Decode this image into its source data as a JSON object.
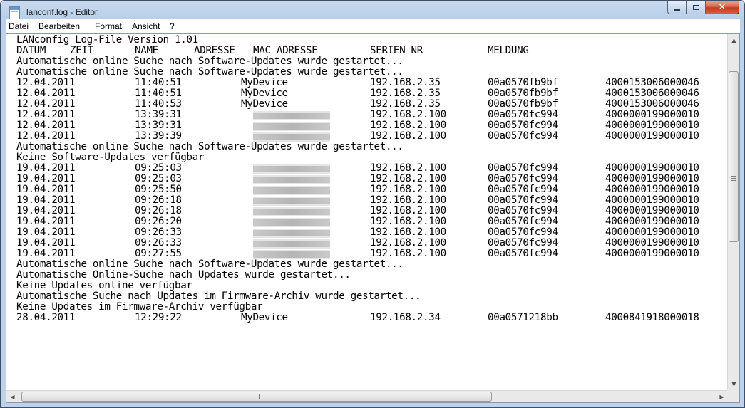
{
  "window": {
    "title": "lanconf.log - Editor"
  },
  "menu": {
    "items": [
      "Datei",
      "Bearbeiten",
      "Format",
      "Ansicht",
      "?"
    ]
  },
  "log": {
    "title_line": "LANconfig Log-File Version 1.01",
    "header": {
      "datum": "DATUM",
      "zeit": "ZEIT",
      "name": "NAME",
      "adresse": "ADRESSE",
      "mac_adresse": "MAC_ADRESSE",
      "serien_nr": "SERIEN_NR",
      "meldung": "MELDUNG"
    },
    "lines": [
      {
        "kind": "message",
        "text": "Automatische online Suche nach Software-Updates wurde gestartet..."
      },
      {
        "kind": "message",
        "text": "Automatische online Suche nach Software-Updates wurde gestartet..."
      },
      {
        "kind": "entry",
        "datum": "12.04.2011",
        "zeit": "11:40:51",
        "name": "MyDevice",
        "adresse": "192.168.2.35",
        "mac": "00a0570fb9bf",
        "serial": "4000153006000046"
      },
      {
        "kind": "entry",
        "datum": "12.04.2011",
        "zeit": "11:40:51",
        "name": "MyDevice",
        "adresse": "192.168.2.35",
        "mac": "00a0570fb9bf",
        "serial": "4000153006000046"
      },
      {
        "kind": "entry",
        "datum": "12.04.2011",
        "zeit": "11:40:53",
        "name": "MyDevice",
        "adresse": "192.168.2.35",
        "mac": "00a0570fb9bf",
        "serial": "4000153006000046"
      },
      {
        "kind": "entry",
        "datum": "12.04.2011",
        "zeit": "13:39:31",
        "name": "",
        "redacted": true,
        "adresse": "192.168.2.100",
        "mac": "00a0570fc994",
        "serial": "4000000199000010"
      },
      {
        "kind": "entry",
        "datum": "12.04.2011",
        "zeit": "13:39:31",
        "name": "",
        "redacted": true,
        "adresse": "192.168.2.100",
        "mac": "00a0570fc994",
        "serial": "4000000199000010"
      },
      {
        "kind": "entry",
        "datum": "12.04.2011",
        "zeit": "13:39:39",
        "name": "",
        "redacted": true,
        "adresse": "192.168.2.100",
        "mac": "00a0570fc994",
        "serial": "4000000199000010"
      },
      {
        "kind": "message",
        "text": "Automatische online Suche nach Software-Updates wurde gestartet..."
      },
      {
        "kind": "message",
        "text": "Keine Software-Updates verfügbar"
      },
      {
        "kind": "entry",
        "datum": "19.04.2011",
        "zeit": "09:25:03",
        "name": "",
        "redacted": true,
        "adresse": "192.168.2.100",
        "mac": "00a0570fc994",
        "serial": "4000000199000010"
      },
      {
        "kind": "entry",
        "datum": "19.04.2011",
        "zeit": "09:25:03",
        "name": "",
        "redacted": true,
        "adresse": "192.168.2.100",
        "mac": "00a0570fc994",
        "serial": "4000000199000010"
      },
      {
        "kind": "entry",
        "datum": "19.04.2011",
        "zeit": "09:25:50",
        "name": "",
        "redacted": true,
        "adresse": "192.168.2.100",
        "mac": "00a0570fc994",
        "serial": "4000000199000010"
      },
      {
        "kind": "entry",
        "datum": "19.04.2011",
        "zeit": "09:26:18",
        "name": "",
        "redacted": true,
        "adresse": "192.168.2.100",
        "mac": "00a0570fc994",
        "serial": "4000000199000010"
      },
      {
        "kind": "entry",
        "datum": "19.04.2011",
        "zeit": "09:26:18",
        "name": "",
        "redacted": true,
        "adresse": "192.168.2.100",
        "mac": "00a0570fc994",
        "serial": "4000000199000010"
      },
      {
        "kind": "entry",
        "datum": "19.04.2011",
        "zeit": "09:26:20",
        "name": "",
        "redacted": true,
        "adresse": "192.168.2.100",
        "mac": "00a0570fc994",
        "serial": "4000000199000010"
      },
      {
        "kind": "entry",
        "datum": "19.04.2011",
        "zeit": "09:26:33",
        "name": "",
        "redacted": true,
        "adresse": "192.168.2.100",
        "mac": "00a0570fc994",
        "serial": "4000000199000010"
      },
      {
        "kind": "entry",
        "datum": "19.04.2011",
        "zeit": "09:26:33",
        "name": "",
        "redacted": true,
        "adresse": "192.168.2.100",
        "mac": "00a0570fc994",
        "serial": "4000000199000010"
      },
      {
        "kind": "entry",
        "datum": "19.04.2011",
        "zeit": "09:27:55",
        "name": "",
        "redacted": true,
        "adresse": "192.168.2.100",
        "mac": "00a0570fc994",
        "serial": "4000000199000010"
      },
      {
        "kind": "message",
        "text": "Automatische online Suche nach Software-Updates wurde gestartet..."
      },
      {
        "kind": "message",
        "text": "Automatische Online-Suche nach Updates wurde gestartet..."
      },
      {
        "kind": "message",
        "text": "Keine Updates online verfügbar"
      },
      {
        "kind": "message",
        "text": "Automatische Suche nach Updates im Firmware-Archiv wurde gestartet..."
      },
      {
        "kind": "message",
        "text": "Keine Updates im Firmware-Archiv verfügbar"
      },
      {
        "kind": "entry",
        "datum": "28.04.2011",
        "zeit": "12:29:22",
        "name": "MyDevice",
        "adresse": "192.168.2.34",
        "mac": "00a0571218bb",
        "serial": "4000841918000018"
      }
    ]
  },
  "icons": {
    "app": "notepad-icon",
    "minimize": "minimize-icon",
    "maximize": "maximize-icon",
    "close": "close-icon",
    "scroll_up": "arrow-up-icon",
    "scroll_down": "arrow-down-icon",
    "scroll_left": "arrow-left-icon",
    "scroll_right": "arrow-right-icon"
  },
  "glyphs": {
    "close": "✕",
    "up": "▲",
    "down": "▼",
    "left": "◀",
    "right": "▶"
  },
  "colors": {
    "titlebar": "#c8daf0",
    "close_button": "#c9452a",
    "text": "#000000",
    "background": "#ffffff"
  }
}
